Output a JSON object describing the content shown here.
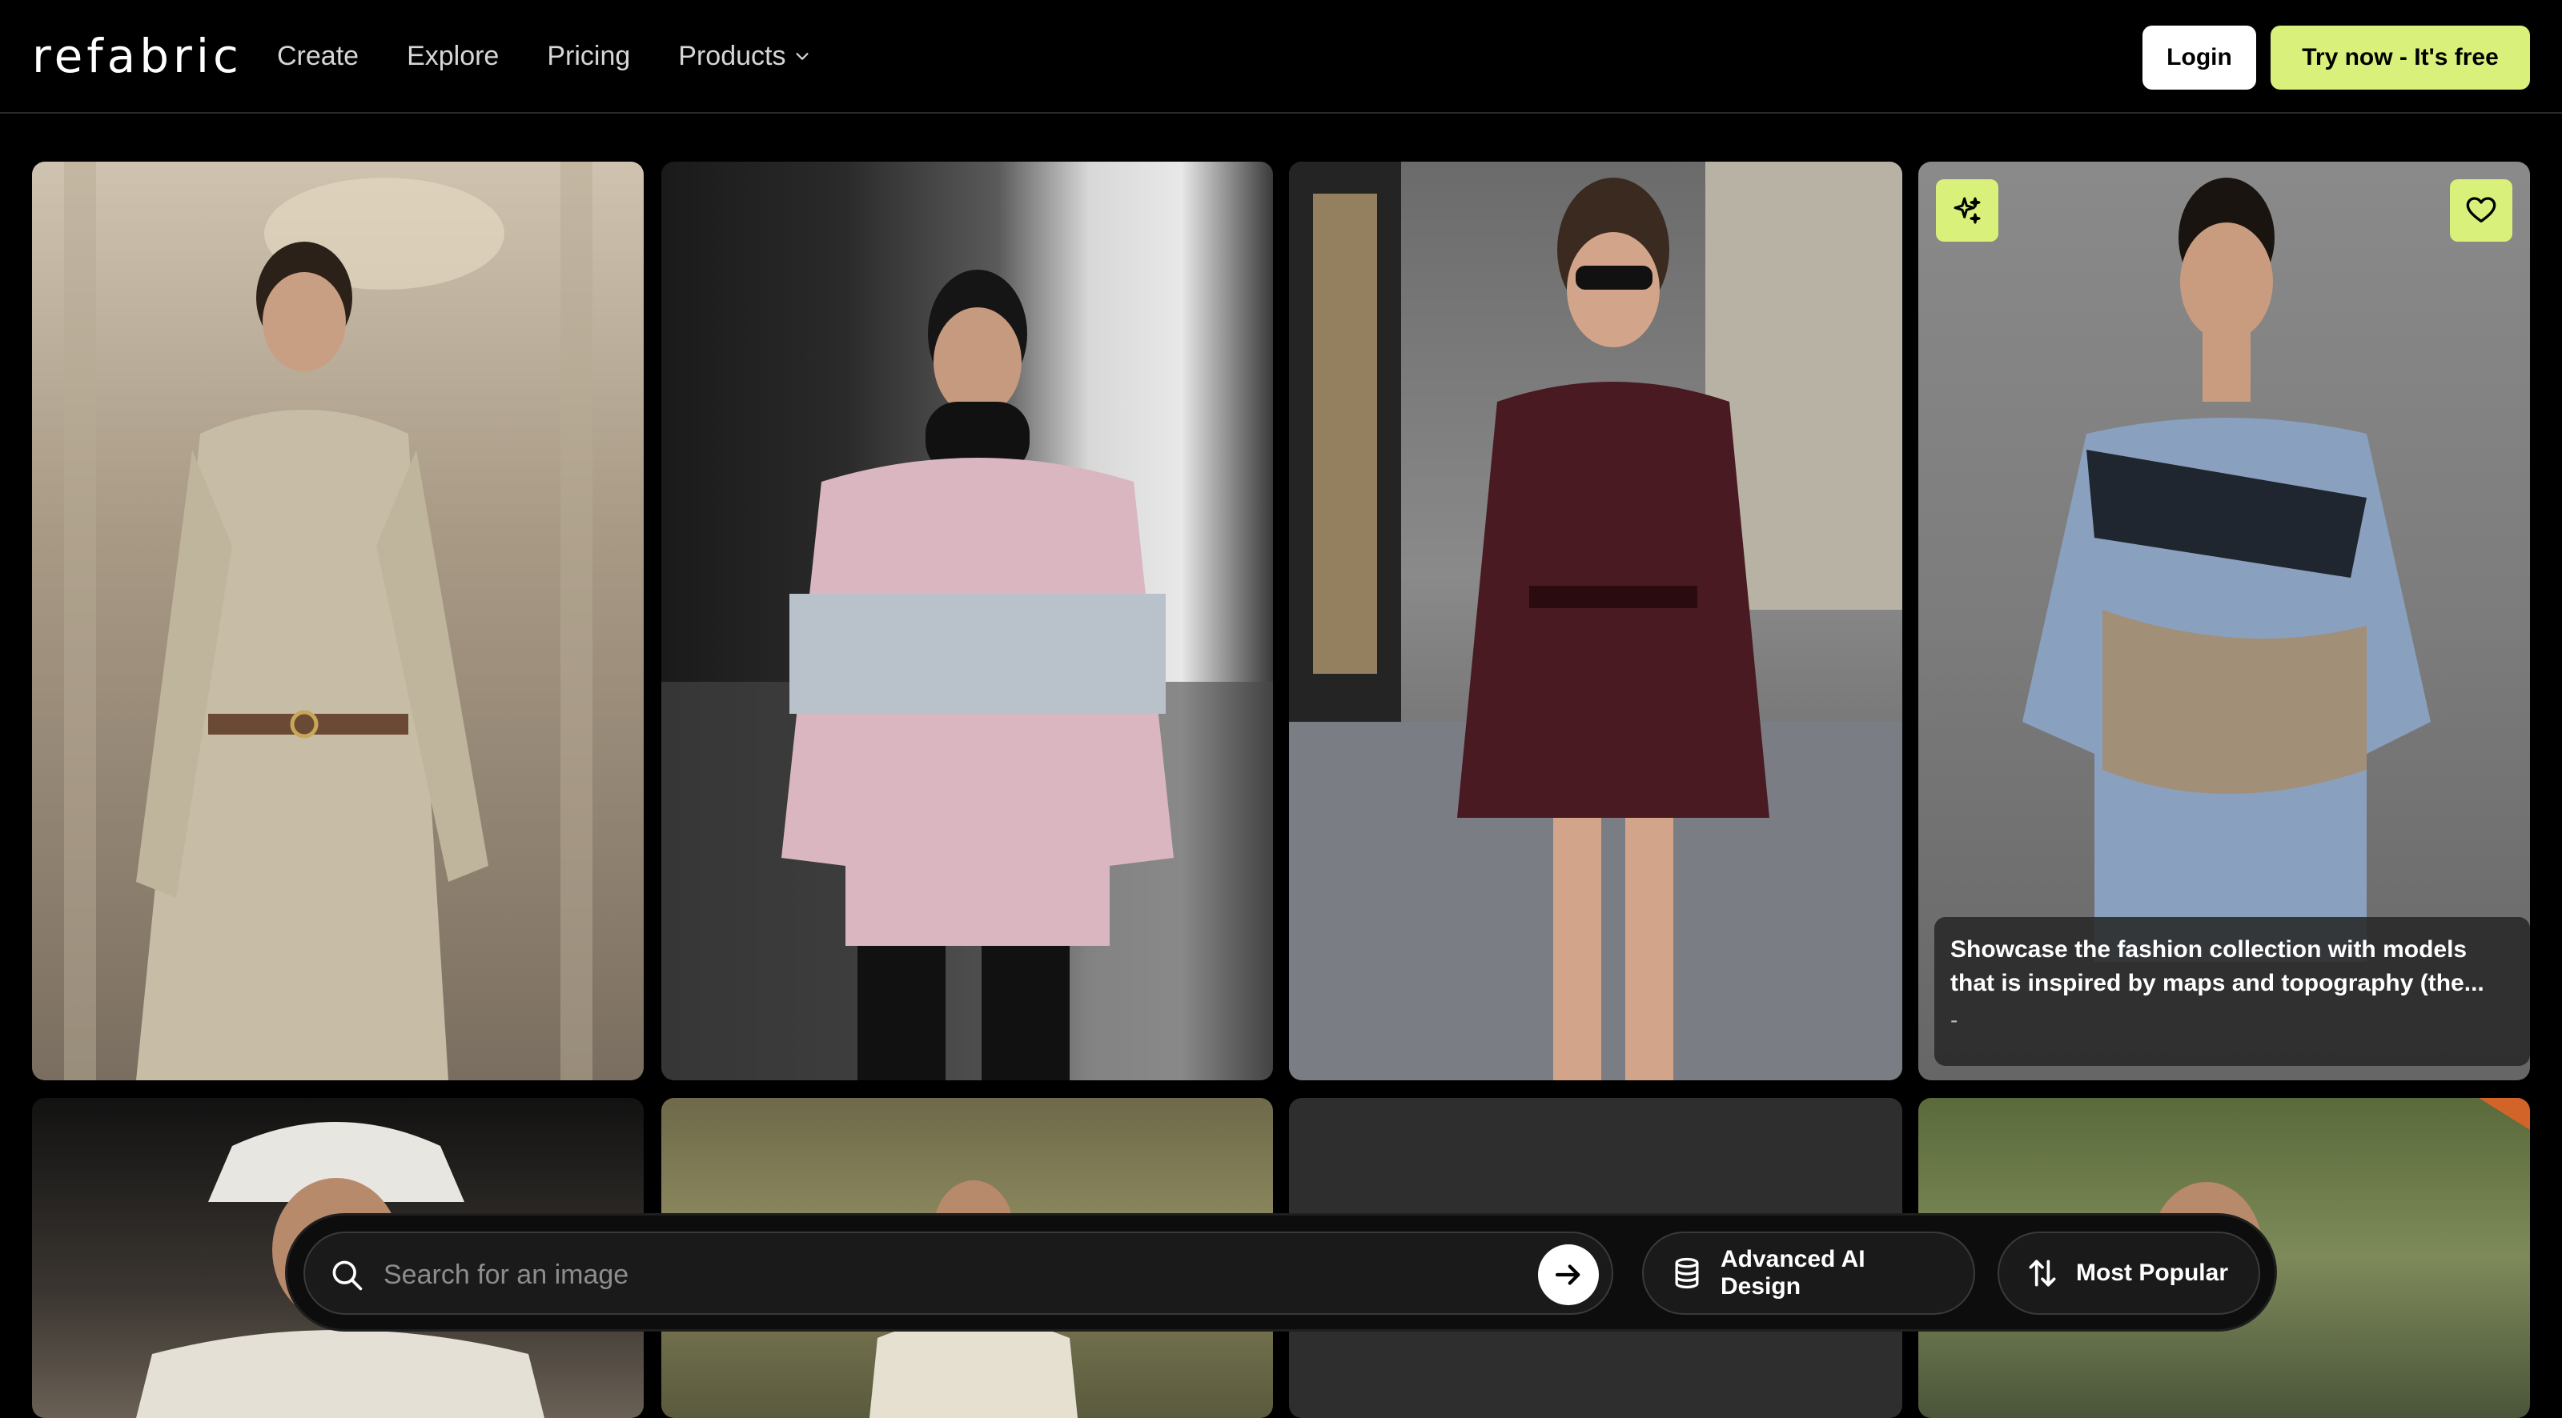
{
  "header": {
    "logo": "refabric",
    "nav": [
      "Create",
      "Explore",
      "Pricing",
      "Products"
    ],
    "login_label": "Login",
    "try_label": "Try now - It's free"
  },
  "gallery": {
    "featured_caption": "Showcase the fashion collection with models that is inspired by maps and topography (the...",
    "featured_sub": "-",
    "featured_left_icon": "sparkles-icon",
    "featured_right_icon": "heart-icon"
  },
  "search": {
    "placeholder": "Search for an image",
    "design_filter_label": "Advanced AI Design",
    "sort_label": "Most Popular"
  },
  "colors": {
    "accent": "#d9f07a",
    "background": "#000000"
  }
}
